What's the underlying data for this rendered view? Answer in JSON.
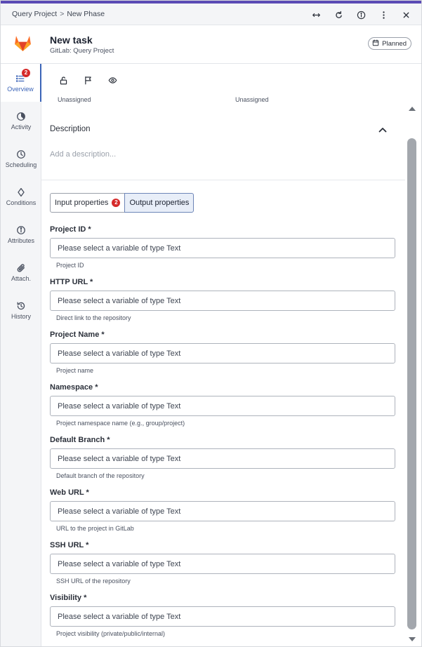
{
  "breadcrumb": {
    "parent": "Query Project",
    "separator": ">",
    "current": "New Phase"
  },
  "header_actions": [
    "expand-icon",
    "refresh-icon",
    "info-icon",
    "more-vertical-icon",
    "close-icon"
  ],
  "task": {
    "title": "New task",
    "subtitle": "GitLab: Query Project",
    "status": "Planned"
  },
  "sidebar": {
    "items": [
      {
        "label": "Overview",
        "icon": "list-icon",
        "badge": "2",
        "active": true
      },
      {
        "label": "Activity",
        "icon": "pie-chart-icon"
      },
      {
        "label": "Scheduling",
        "icon": "clock-icon"
      },
      {
        "label": "Conditions",
        "icon": "diamond-icon"
      },
      {
        "label": "Attributes",
        "icon": "info-icon"
      },
      {
        "label": "Attach.",
        "icon": "paperclip-icon"
      },
      {
        "label": "History",
        "icon": "history-icon"
      }
    ]
  },
  "toolbar": {
    "icons": [
      "unlock-icon",
      "flag-icon",
      "eye-icon"
    ]
  },
  "assignees": {
    "left": "Unassigned",
    "right": "Unassigned"
  },
  "description": {
    "title": "Description",
    "placeholder": "Add a description..."
  },
  "tabs": {
    "input_label": "Input properties",
    "input_badge": "2",
    "output_label": "Output properties",
    "active": "output"
  },
  "fields": [
    {
      "label": "Project ID *",
      "placeholder": "Please select a variable of type Text",
      "help": "Project ID"
    },
    {
      "label": "HTTP URL *",
      "placeholder": "Please select a variable of type Text",
      "help": "Direct link to the repository"
    },
    {
      "label": "Project Name *",
      "placeholder": "Please select a variable of type Text",
      "help": "Project name"
    },
    {
      "label": "Namespace *",
      "placeholder": "Please select a variable of type Text",
      "help": "Project namespace name (e.g., group/project)"
    },
    {
      "label": "Default Branch *",
      "placeholder": "Please select a variable of type Text",
      "help": "Default branch of the repository"
    },
    {
      "label": "Web URL *",
      "placeholder": "Please select a variable of type Text",
      "help": "URL to the project in GitLab"
    },
    {
      "label": "SSH URL *",
      "placeholder": "Please select a variable of type Text",
      "help": "SSH URL of the repository"
    },
    {
      "label": "Visibility *",
      "placeholder": "Please select a variable of type Text",
      "help": "Project visibility (private/public/internal)"
    }
  ],
  "colors": {
    "accent": "#3b64b8",
    "badge": "#d52a2a",
    "top_line": "#5b4bb5",
    "gitlab_orange": "#e24329"
  }
}
